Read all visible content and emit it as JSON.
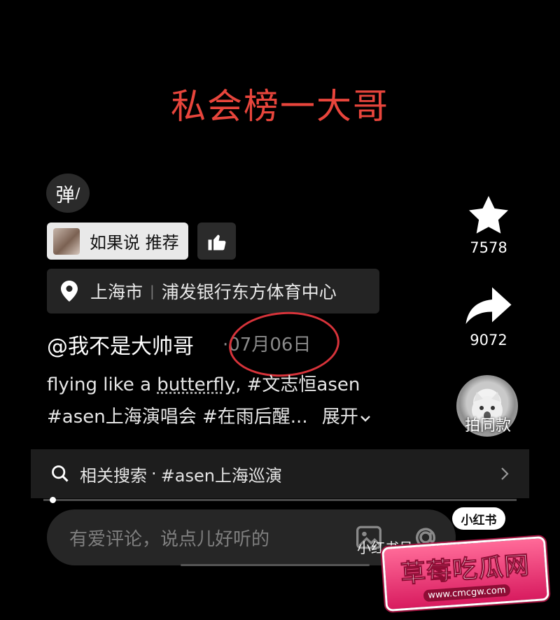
{
  "headline": "私会榜一大哥",
  "danmaku_label": "弹",
  "recommend": {
    "label": "如果说 推荐"
  },
  "location": {
    "city": "上海市",
    "place": "浦发银行东方体育中心"
  },
  "post": {
    "author": "@我不是大帅哥",
    "date": "07月06日",
    "desc_line1_a": "flying like a ",
    "desc_line1_link": "butterfly",
    "desc_line1_b": ", #文志恒asen",
    "desc_line2": "#asen上海演唱会 #在雨后醒...",
    "expand": "展开"
  },
  "actions": {
    "favorites_count": "7578",
    "shares_count": "9072",
    "same_style_label": "拍同款"
  },
  "related_search": {
    "prefix": "相关搜索",
    "dot": "·",
    "query": "#asen上海巡演"
  },
  "progress": {
    "fraction": 0.02
  },
  "comment": {
    "placeholder": "有爱评论，说点儿好听的"
  },
  "watermarks": {
    "xhs_badge": "小红书",
    "xhs_id": "小红书号：496168657",
    "site_name": "草莓吃瓜网",
    "site_url": "www.cmcgw.com"
  },
  "colors": {
    "headline": "#e8453c",
    "annotation_circle": "#d7333a"
  }
}
